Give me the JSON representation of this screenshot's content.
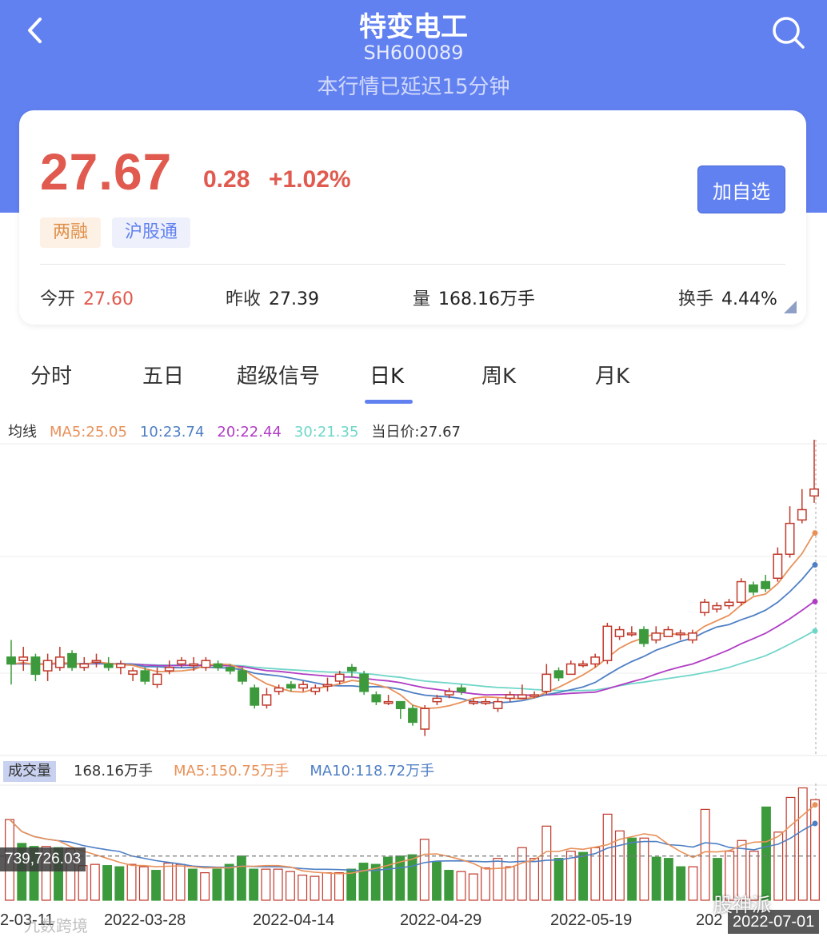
{
  "header": {
    "title": "特变电工",
    "code": "SH600089",
    "delay_note": "本行情已延迟15分钟"
  },
  "quote": {
    "price": "27.67",
    "change": "0.28",
    "change_pct": "+1.02%",
    "watch_label": "加自选",
    "tags": [
      "两融",
      "沪股通"
    ],
    "open_label": "今开",
    "open_value": "27.60",
    "prev_label": "昨收",
    "prev_value": "27.39",
    "volume_label": "量",
    "volume_value": "168.16万手",
    "turnover_label": "换手",
    "turnover_value": "4.44%"
  },
  "tabs": [
    "分时",
    "五日",
    "超级信号",
    "日K",
    "周K",
    "月K"
  ],
  "active_tab": "日K",
  "ma_legend": {
    "label": "均线",
    "ma5": "MA5:25.05",
    "ma10": "10:23.74",
    "ma20": "20:22.44",
    "ma30": "30:21.35",
    "current": "当日价:27.67"
  },
  "volume_legend": {
    "label": "成交量",
    "value": "168.16万手",
    "ma5": "MA5:150.75万手",
    "ma10": "MA10:118.72万手"
  },
  "crosshair_value": "739,726.03",
  "dates": [
    "2-03-11",
    "2022-03-28",
    "2022-04-14",
    "2022-04-29",
    "2022-05-19",
    "202",
    "2022-07-01"
  ],
  "watermarks": [
    "九数跨境",
    "股神派"
  ],
  "colors": {
    "brand": "#6281f0",
    "up": "#c0392b",
    "down": "#3c9a3c",
    "ma5": "#e8915a",
    "ma10": "#4e7fc4",
    "ma20": "#b03cc4",
    "ma30": "#6fd6c8"
  },
  "chart_data": {
    "type": "candlestick",
    "ylim": [
      19.5,
      28.5
    ],
    "candles": [
      [
        22.3,
        22.1,
        22.8,
        21.5
      ],
      [
        22.2,
        22.3,
        22.6,
        21.9
      ],
      [
        22.3,
        21.8,
        22.4,
        21.6
      ],
      [
        21.9,
        22.2,
        22.4,
        21.6
      ],
      [
        22.0,
        22.3,
        22.6,
        21.9
      ],
      [
        22.4,
        22.0,
        22.5,
        21.9
      ],
      [
        22.0,
        22.1,
        22.3,
        21.9
      ],
      [
        22.2,
        22.2,
        22.4,
        22.0
      ],
      [
        22.1,
        22.0,
        22.3,
        21.9
      ],
      [
        22.0,
        22.1,
        22.2,
        21.8
      ],
      [
        21.8,
        21.9,
        22.0,
        21.6
      ],
      [
        21.9,
        21.6,
        22.0,
        21.5
      ],
      [
        21.5,
        21.8,
        22.0,
        21.4
      ],
      [
        21.9,
        22.0,
        22.2,
        21.8
      ],
      [
        22.1,
        22.2,
        22.3,
        22.0
      ],
      [
        22.1,
        22.1,
        22.3,
        21.9
      ],
      [
        22.0,
        22.2,
        22.3,
        21.9
      ],
      [
        22.1,
        22.0,
        22.2,
        21.9
      ],
      [
        22.0,
        21.9,
        22.1,
        21.8
      ],
      [
        21.9,
        21.6,
        22.0,
        21.5
      ],
      [
        21.4,
        20.9,
        21.5,
        20.8
      ],
      [
        20.9,
        21.2,
        21.4,
        20.8
      ],
      [
        21.3,
        21.4,
        21.5,
        21.2
      ],
      [
        21.5,
        21.4,
        21.6,
        21.3
      ],
      [
        21.4,
        21.5,
        21.6,
        21.3
      ],
      [
        21.3,
        21.4,
        21.5,
        21.2
      ],
      [
        21.5,
        21.5,
        21.7,
        21.3
      ],
      [
        21.6,
        21.8,
        21.9,
        21.5
      ],
      [
        22.0,
        21.9,
        22.1,
        21.7
      ],
      [
        21.8,
        21.3,
        21.9,
        21.2
      ],
      [
        21.2,
        21.0,
        21.3,
        20.9
      ],
      [
        21.0,
        21.0,
        21.2,
        20.9
      ],
      [
        21.0,
        20.8,
        21.0,
        20.5
      ],
      [
        20.8,
        20.4,
        20.9,
        20.3
      ],
      [
        20.2,
        20.8,
        20.9,
        20.0
      ],
      [
        21.0,
        21.1,
        21.2,
        20.9
      ],
      [
        21.2,
        21.3,
        21.4,
        21.1
      ],
      [
        21.4,
        21.3,
        21.5,
        21.2
      ],
      [
        21.0,
        21.0,
        21.1,
        20.9
      ],
      [
        21.0,
        21.0,
        21.1,
        20.9
      ],
      [
        20.8,
        21.0,
        21.1,
        20.7
      ],
      [
        21.1,
        21.2,
        21.3,
        21.0
      ],
      [
        21.1,
        21.2,
        21.5,
        21.1
      ],
      [
        21.2,
        21.2,
        21.3,
        21.1
      ],
      [
        21.3,
        21.8,
        22.1,
        21.2
      ],
      [
        21.9,
        21.7,
        22.0,
        21.6
      ],
      [
        21.8,
        22.1,
        22.2,
        21.8
      ],
      [
        22.1,
        22.1,
        22.2,
        22.0
      ],
      [
        22.1,
        22.3,
        22.4,
        22.0
      ],
      [
        22.2,
        23.2,
        23.3,
        22.1
      ],
      [
        22.9,
        23.1,
        23.2,
        22.8
      ],
      [
        23.0,
        23.0,
        23.2,
        22.9
      ],
      [
        23.1,
        22.7,
        23.2,
        22.6
      ],
      [
        22.8,
        23.0,
        23.2,
        22.7
      ],
      [
        22.9,
        23.1,
        23.2,
        22.9
      ],
      [
        23.0,
        23.0,
        23.1,
        22.8
      ],
      [
        22.8,
        23.0,
        23.1,
        22.7
      ],
      [
        23.6,
        23.9,
        24.0,
        23.5
      ],
      [
        23.7,
        23.8,
        23.9,
        23.6
      ],
      [
        23.8,
        23.9,
        24.0,
        23.7
      ],
      [
        23.9,
        24.5,
        24.6,
        23.8
      ],
      [
        24.4,
        24.2,
        24.5,
        24.1
      ],
      [
        24.5,
        24.3,
        24.7,
        24.2
      ],
      [
        24.6,
        25.3,
        25.5,
        24.5
      ],
      [
        25.3,
        26.2,
        26.7,
        25.2
      ],
      [
        26.3,
        26.6,
        27.2,
        26.2
      ],
      [
        27.0,
        27.2,
        29.5,
        26.8
      ]
    ],
    "volume_ylim": [
      0,
      1900000
    ],
    "volumes": [
      [
        1350000,
        "up"
      ],
      [
        950000,
        "down"
      ],
      [
        900000,
        "down"
      ],
      [
        900000,
        "up"
      ],
      [
        880000,
        "down"
      ],
      [
        860000,
        "up"
      ],
      [
        580000,
        "up"
      ],
      [
        600000,
        "up"
      ],
      [
        580000,
        "down"
      ],
      [
        560000,
        "down"
      ],
      [
        600000,
        "up"
      ],
      [
        560000,
        "up"
      ],
      [
        500000,
        "down"
      ],
      [
        620000,
        "up"
      ],
      [
        600000,
        "up"
      ],
      [
        520000,
        "down"
      ],
      [
        460000,
        "up"
      ],
      [
        520000,
        "down"
      ],
      [
        600000,
        "down"
      ],
      [
        740000,
        "down"
      ],
      [
        520000,
        "down"
      ],
      [
        520000,
        "up"
      ],
      [
        520000,
        "up"
      ],
      [
        480000,
        "up"
      ],
      [
        420000,
        "up"
      ],
      [
        400000,
        "up"
      ],
      [
        460000,
        "up"
      ],
      [
        460000,
        "up"
      ],
      [
        520000,
        "down"
      ],
      [
        620000,
        "down"
      ],
      [
        600000,
        "down"
      ],
      [
        720000,
        "down"
      ],
      [
        740000,
        "down"
      ],
      [
        760000,
        "down"
      ],
      [
        1020000,
        "up"
      ],
      [
        640000,
        "down"
      ],
      [
        500000,
        "down"
      ],
      [
        480000,
        "up"
      ],
      [
        440000,
        "up"
      ],
      [
        540000,
        "up"
      ],
      [
        700000,
        "up"
      ],
      [
        560000,
        "up"
      ],
      [
        880000,
        "up"
      ],
      [
        700000,
        "up"
      ],
      [
        1240000,
        "up"
      ],
      [
        700000,
        "down"
      ],
      [
        820000,
        "up"
      ],
      [
        800000,
        "down"
      ],
      [
        880000,
        "up"
      ],
      [
        1440000,
        "up"
      ],
      [
        1160000,
        "up"
      ],
      [
        1040000,
        "down"
      ],
      [
        1040000,
        "up"
      ],
      [
        720000,
        "down"
      ],
      [
        700000,
        "down"
      ],
      [
        560000,
        "down"
      ],
      [
        560000,
        "up"
      ],
      [
        1520000,
        "up"
      ],
      [
        700000,
        "down"
      ],
      [
        820000,
        "up"
      ],
      [
        1000000,
        "up"
      ],
      [
        820000,
        "up"
      ],
      [
        1560000,
        "down"
      ],
      [
        1140000,
        "up"
      ],
      [
        1720000,
        "up"
      ],
      [
        1880000,
        "up"
      ],
      [
        1682000,
        "up"
      ]
    ]
  }
}
